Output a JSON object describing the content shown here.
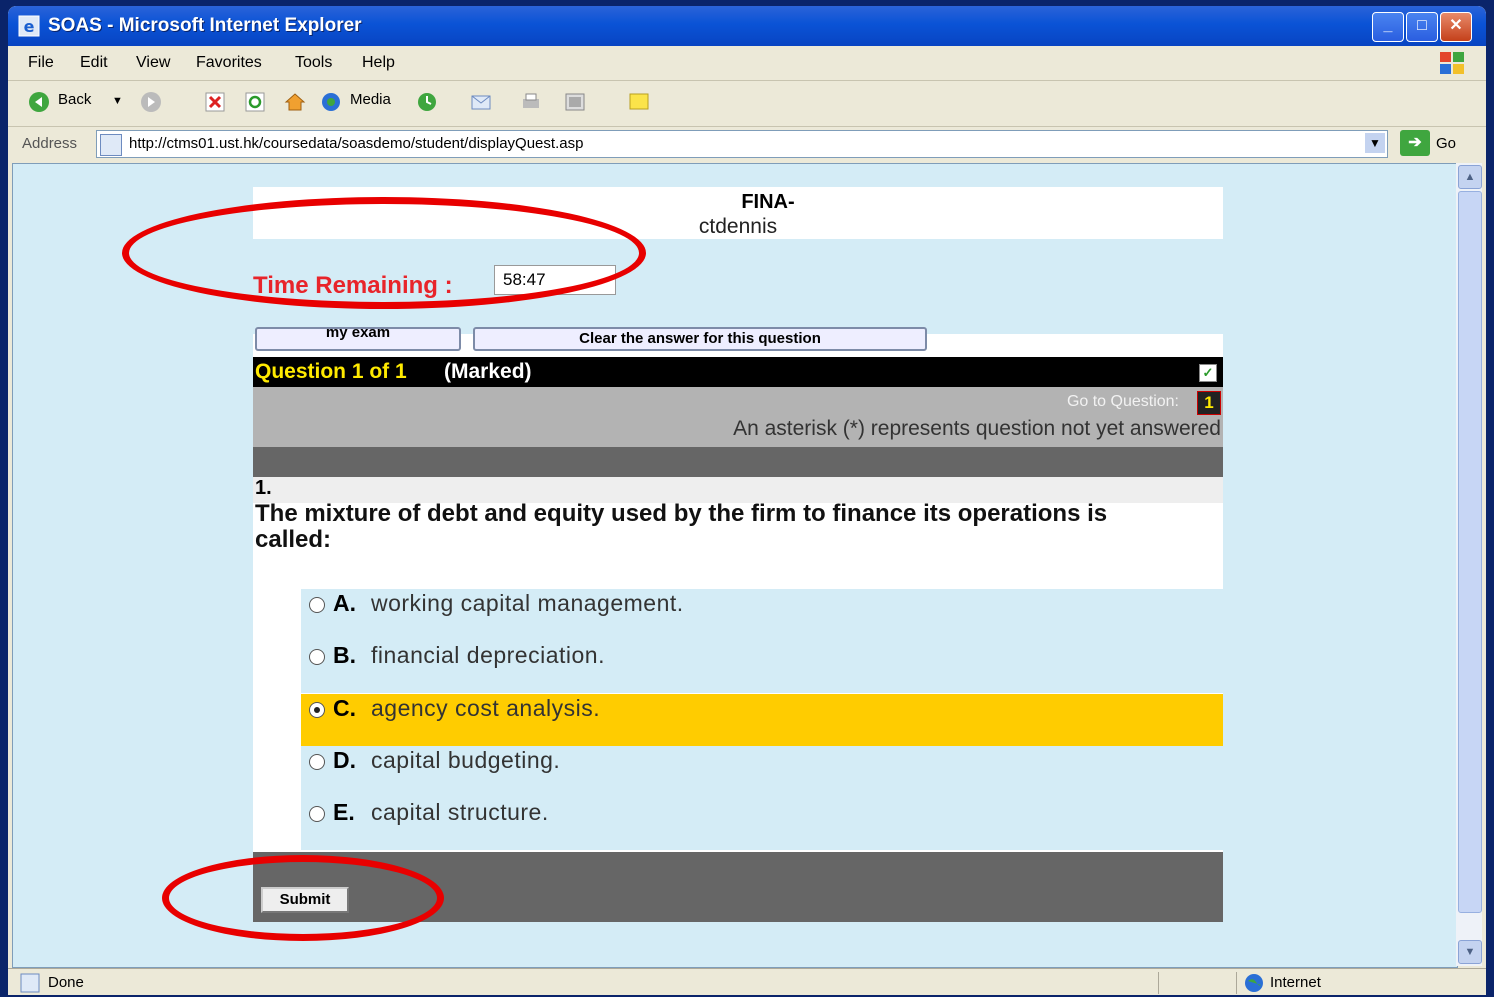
{
  "window": {
    "title": "SOAS - Microsoft Internet Explorer",
    "minimize": "_",
    "maximize": "□",
    "close": "✕"
  },
  "menu": [
    "File",
    "Edit",
    "View",
    "Favorites",
    "Tools",
    "Help"
  ],
  "toolbar": {
    "back": "Back",
    "media": "Media"
  },
  "address": {
    "label": "Address",
    "url": "http://ctms01.ust.hk/coursedata/soasdemo/student/displayQuest.asp",
    "go": "Go"
  },
  "status": {
    "text": "Done",
    "zone": "Internet"
  },
  "page": {
    "course": "FINA-",
    "user": "ctdennis",
    "time_label": "Time Remaining :",
    "time_value": "58:47",
    "btn_exam": "my exam",
    "btn_clear": "Clear the answer for this question",
    "question_header": "Question 1 of 1",
    "marked": "(Marked)",
    "goto_label": "Go to Question:",
    "goto_number": "1",
    "asterisk_note": "An asterisk (*) represents question not yet answered",
    "question_number": "1.",
    "question_text": "The mixture of debt and equity used by the firm to finance its operations is called:",
    "options": [
      {
        "letter": "A.",
        "text": "working capital management.",
        "selected": false
      },
      {
        "letter": "B.",
        "text": "financial depreciation.",
        "selected": false
      },
      {
        "letter": "C.",
        "text": "agency cost analysis.",
        "selected": true
      },
      {
        "letter": "D.",
        "text": "capital budgeting.",
        "selected": false
      },
      {
        "letter": "E.",
        "text": "capital structure.",
        "selected": false
      }
    ],
    "submit": "Submit"
  },
  "colors": {
    "annotation": "#e80000",
    "time_label": "#e8242a",
    "selected_option": "#ffcc00",
    "option_bg": "#d4ecf6"
  }
}
